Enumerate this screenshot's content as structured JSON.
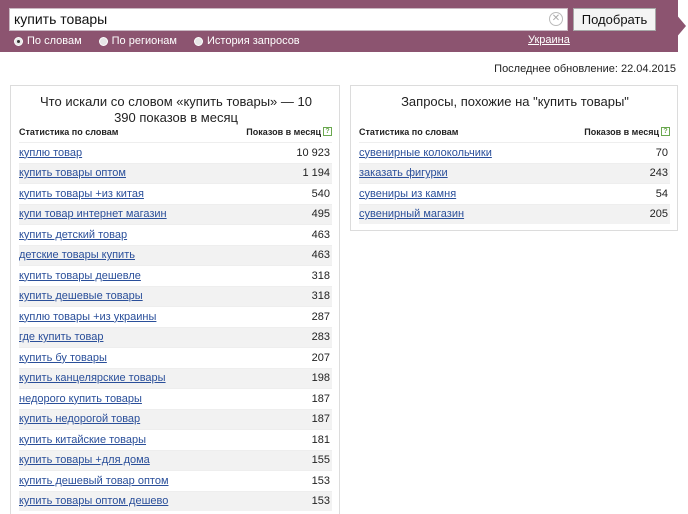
{
  "search": {
    "query": "купить товары",
    "submit_label": "Подобрать",
    "modes": [
      {
        "label": "По словам",
        "checked": true
      },
      {
        "label": "По регионам",
        "checked": false
      },
      {
        "label": "История запросов",
        "checked": false
      }
    ],
    "region": "Украина"
  },
  "last_update": "Последнее обновление: 22.04.2015",
  "left_panel": {
    "title": "Что искали со словом «купить товары» — 10 390 показов в месяц",
    "col_phrase": "Статистика по словам",
    "col_count": "Показов в месяц",
    "rows": [
      {
        "phrase": "куплю товар",
        "count": "10 923"
      },
      {
        "phrase": "купить товары оптом",
        "count": "1 194"
      },
      {
        "phrase": "купить товары +из китая",
        "count": "540"
      },
      {
        "phrase": "купи товар интернет магазин",
        "count": "495"
      },
      {
        "phrase": "купить детский товар",
        "count": "463"
      },
      {
        "phrase": "детские товары купить",
        "count": "463"
      },
      {
        "phrase": "купить товары дешевле",
        "count": "318"
      },
      {
        "phrase": "купить дешевые товары",
        "count": "318"
      },
      {
        "phrase": "куплю товары +из украины",
        "count": "287"
      },
      {
        "phrase": "где купить товар",
        "count": "283"
      },
      {
        "phrase": "купить бу товары",
        "count": "207"
      },
      {
        "phrase": "купить канцелярские товары",
        "count": "198"
      },
      {
        "phrase": "недорого купить товары",
        "count": "187"
      },
      {
        "phrase": "купить недорогой товар",
        "count": "187"
      },
      {
        "phrase": "купить китайские товары",
        "count": "181"
      },
      {
        "phrase": "купить товары +для дома",
        "count": "155"
      },
      {
        "phrase": "купить дешевый товар оптом",
        "count": "153"
      },
      {
        "phrase": "купить товары оптом дешево",
        "count": "153"
      }
    ]
  },
  "right_panel": {
    "title": "Запросы, похожие на \"купить товары\"",
    "col_phrase": "Статистика по словам",
    "col_count": "Показов в месяц",
    "rows": [
      {
        "phrase": "сувенирные колокольчики",
        "count": "70"
      },
      {
        "phrase": "заказать фигурки",
        "count": "243"
      },
      {
        "phrase": "сувениры из камня",
        "count": "54"
      },
      {
        "phrase": "сувенирный магазин",
        "count": "205"
      }
    ]
  },
  "colors": {
    "header_bg": "#8c5470",
    "link": "#2a4f9a",
    "help": "#6aa84f"
  }
}
